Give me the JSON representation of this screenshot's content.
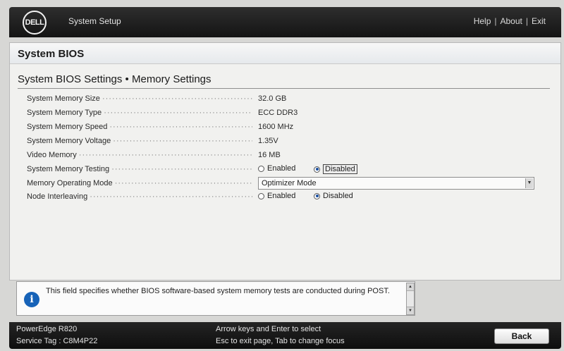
{
  "header": {
    "logo_text": "DELL",
    "app_title": "System Setup",
    "links": [
      "Help",
      "About",
      "Exit"
    ],
    "separator": "|"
  },
  "section": {
    "title": "System BIOS"
  },
  "page": {
    "title": "System BIOS Settings • Memory Settings"
  },
  "settings": {
    "rows": [
      {
        "label": "System Memory Size",
        "value": "32.0 GB"
      },
      {
        "label": "System Memory Type",
        "value": "ECC DDR3"
      },
      {
        "label": "System Memory Speed",
        "value": "1600 MHz"
      },
      {
        "label": "System Memory Voltage",
        "value": "1.35V"
      },
      {
        "label": "Video Memory",
        "value": "16 MB"
      }
    ],
    "memory_testing": {
      "label": "System Memory Testing",
      "option_enabled": "Enabled",
      "option_disabled": "Disabled",
      "selected": "Disabled"
    },
    "operating_mode": {
      "label": "Memory Operating Mode",
      "value": "Optimizer Mode"
    },
    "node_interleaving": {
      "label": "Node Interleaving",
      "option_enabled": "Enabled",
      "option_disabled": "Disabled",
      "selected": "Disabled"
    },
    "leader": "·································································"
  },
  "info": {
    "icon": "info-icon",
    "text": "This field specifies whether BIOS software-based system memory tests are conducted during POST."
  },
  "footer": {
    "model": "PowerEdge R820",
    "service_tag": "Service Tag : C8M4P22",
    "help_line1": "Arrow keys and Enter to select",
    "help_line2": "Esc to exit page, Tab to change focus",
    "back_label": "Back"
  },
  "colors": {
    "header_bg": "#1f1f1f",
    "panel_bg": "#f1f1ef",
    "info_icon": "#1763b8",
    "radio_selected": "#1a4fa0"
  }
}
